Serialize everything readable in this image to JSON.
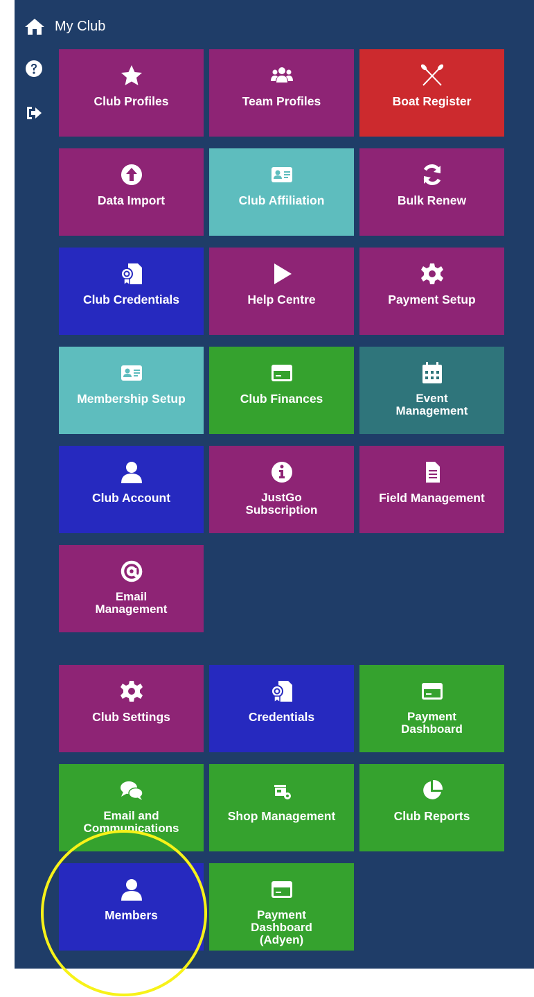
{
  "header": {
    "title": "My Club",
    "home_icon": "home-icon"
  },
  "sidebar": [
    {
      "name": "help-icon",
      "label": "Help"
    },
    {
      "name": "logout-icon",
      "label": "Log out"
    }
  ],
  "colors": {
    "panel": "#1f3d68",
    "purple": "#8e2475",
    "red": "#cc2a2e",
    "teal": "#5ebdbe",
    "blue": "#2629bf",
    "green": "#35a22e",
    "darkteal": "#2f757b",
    "highlight_ring": "#f7f219"
  },
  "tiles": [
    {
      "label": "Club Profiles",
      "icon": "star-icon",
      "color": "purple"
    },
    {
      "label": "Team Profiles",
      "icon": "users-icon",
      "color": "purple"
    },
    {
      "label": "Boat Register",
      "icon": "crossed-oars-icon",
      "color": "red"
    },
    {
      "label": "Data Import",
      "icon": "upload-circle-icon",
      "color": "purple"
    },
    {
      "label": "Club Affiliation",
      "icon": "id-card-icon",
      "color": "teal"
    },
    {
      "label": "Bulk Renew",
      "icon": "sync-icon",
      "color": "purple"
    },
    {
      "label": "Club Credentials",
      "icon": "certificate-file-icon",
      "color": "blue"
    },
    {
      "label": "Help Centre",
      "icon": "play-icon",
      "color": "purple"
    },
    {
      "label": "Payment Setup",
      "icon": "gear-icon",
      "color": "purple"
    },
    {
      "label": "Membership Setup",
      "icon": "id-card-icon",
      "color": "teal"
    },
    {
      "label": "Club Finances",
      "icon": "credit-card-icon",
      "color": "green"
    },
    {
      "label": "Event\nManagement",
      "icon": "calendar-icon",
      "color": "darkteal"
    },
    {
      "label": "Club Account",
      "icon": "user-icon",
      "color": "blue"
    },
    {
      "label": "JustGo\nSubscription",
      "icon": "info-circle-icon",
      "color": "purple"
    },
    {
      "label": "Field Management",
      "icon": "document-icon",
      "color": "purple"
    },
    {
      "label": "Email\nManagement",
      "icon": "at-sign-icon",
      "color": "purple"
    },
    {
      "label": "Club Settings",
      "icon": "gear-icon",
      "color": "purple"
    },
    {
      "label": "Credentials",
      "icon": "certificate-file-icon",
      "color": "blue"
    },
    {
      "label": "Payment\nDashboard",
      "icon": "credit-card-icon",
      "color": "green"
    },
    {
      "label": "Email and\nCommunications",
      "icon": "comments-icon",
      "color": "green"
    },
    {
      "label": "Shop Management",
      "icon": "store-settings-icon",
      "color": "green"
    },
    {
      "label": "Club Reports",
      "icon": "pie-chart-icon",
      "color": "green"
    },
    {
      "label": "Members",
      "icon": "user-icon",
      "color": "blue"
    },
    {
      "label": "Payment\nDashboard\n(Adyen)",
      "icon": "credit-card-icon",
      "color": "green"
    }
  ]
}
